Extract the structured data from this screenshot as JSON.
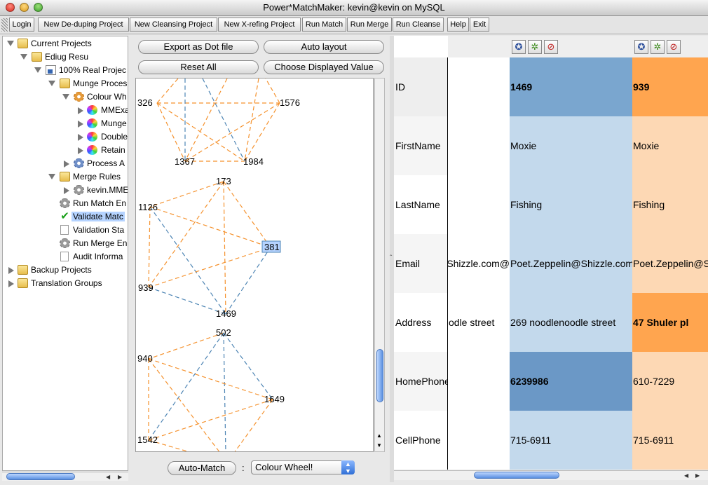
{
  "window": {
    "title": "Power*MatchMaker: kevin@kevin on MySQL"
  },
  "toolbar": {
    "buttons": [
      "Login",
      "New De-duping Project",
      "New Cleansing Project",
      "New X-refing Project",
      "Run Match",
      "Run Merge",
      "Run Cleanse",
      "Help",
      "Exit"
    ]
  },
  "tree": {
    "items": [
      {
        "label": "Current Projects"
      },
      {
        "label": "Ediug Resu"
      },
      {
        "label": "100% Real Projec"
      },
      {
        "label": "Munge Proces"
      },
      {
        "label": "Colour Wh"
      },
      {
        "label": "MMExa"
      },
      {
        "label": "Munge"
      },
      {
        "label": "Double"
      },
      {
        "label": "Retain"
      },
      {
        "label": "Process A"
      },
      {
        "label": "Merge Rules"
      },
      {
        "label": "kevin.MME"
      },
      {
        "label": "Run Match En"
      },
      {
        "label": "Validate Matc"
      },
      {
        "label": "Validation Sta"
      },
      {
        "label": "Run Merge En"
      },
      {
        "label": "Audit Informa"
      },
      {
        "label": "Backup Projects"
      },
      {
        "label": "Translation Groups"
      }
    ]
  },
  "graph_panel": {
    "export_label": "Export as Dot file",
    "auto_layout_label": "Auto layout",
    "reset_label": "Reset All",
    "choose_value_label": "Choose Displayed Value",
    "auto_match_label": "Auto-Match",
    "colon": ":",
    "combo_value": "Colour Wheel!",
    "nodes": [
      "326",
      "1576",
      "1367",
      "1984",
      "173",
      "1126",
      "381",
      "939",
      "1469",
      "502",
      "940",
      "1649",
      "1542"
    ]
  },
  "table": {
    "rows": [
      {
        "label": "ID",
        "partial": "",
        "a": "1469",
        "b": "939"
      },
      {
        "label": "FirstName",
        "partial": "",
        "a": "Moxie",
        "b": "Moxie"
      },
      {
        "label": "LastName",
        "partial": "",
        "a": "Fishing",
        "b": "Fishing"
      },
      {
        "label": "Email",
        "partial": "@Shizzle.com",
        "a": "Poet.Zeppelin@Shizzle.com",
        "b": "Poet.Zeppelin@S"
      },
      {
        "label": "Address",
        "partial": "odle street",
        "a": "269 noodlenoodle street",
        "b": "47 Shuler pl"
      },
      {
        "label": "HomePhone",
        "partial": "",
        "a": "6239986",
        "b": "610-7229"
      },
      {
        "label": "CellPhone",
        "partial": "",
        "a": "715-6911",
        "b": "715-6911"
      }
    ],
    "colors": {
      "blue_dark": "#7aa6cf",
      "blue_darker": "#6b98c6",
      "blue_light": "#c3d9ec",
      "orange_dark": "#ffa54f",
      "orange_light": "#fdd8b4"
    }
  },
  "colors": {
    "edge_orange": "#f5922e",
    "edge_blue": "#4e85b4",
    "selected_node": "#b5d3ff"
  }
}
